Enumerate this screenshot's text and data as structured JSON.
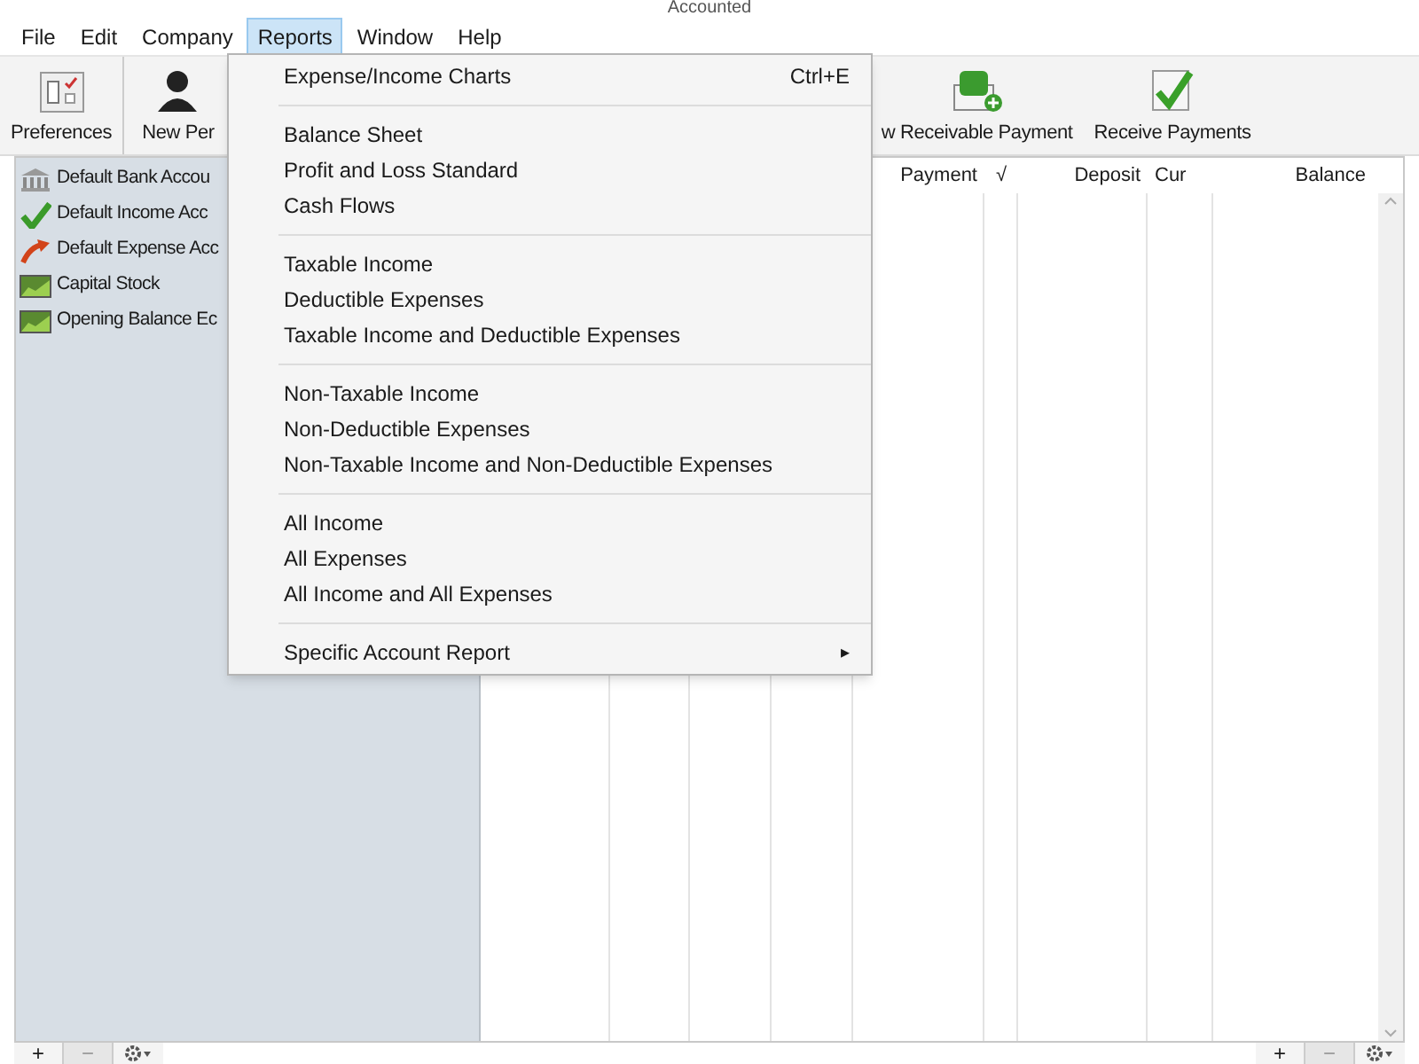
{
  "window": {
    "title": "Accounted"
  },
  "menubar": [
    {
      "label": "File",
      "selected": false
    },
    {
      "label": "Edit",
      "selected": false
    },
    {
      "label": "Company",
      "selected": false
    },
    {
      "label": "Reports",
      "selected": true
    },
    {
      "label": "Window",
      "selected": false
    },
    {
      "label": "Help",
      "selected": false
    }
  ],
  "toolbar": [
    {
      "label": "Preferences"
    },
    {
      "label": "New Per"
    },
    {
      "label": "w Receivable Payment"
    },
    {
      "label": "Receive Payments"
    }
  ],
  "sidebar": {
    "items": [
      {
        "label": "Default Bank Accou"
      },
      {
        "label": "Default Income Acc"
      },
      {
        "label": "Default Expense Acc"
      },
      {
        "label": "Capital Stock"
      },
      {
        "label": "Opening Balance Ec"
      }
    ]
  },
  "table": {
    "columns": [
      "Payment",
      "√",
      "Deposit",
      "Cur",
      "Balance"
    ]
  },
  "menu": {
    "items": [
      {
        "kind": "item",
        "label": "Expense/Income Charts",
        "shortcut": "Ctrl+E"
      },
      {
        "kind": "separator"
      },
      {
        "kind": "item",
        "label": "Balance Sheet"
      },
      {
        "kind": "item",
        "label": "Profit and Loss Standard"
      },
      {
        "kind": "item",
        "label": "Cash Flows"
      },
      {
        "kind": "separator"
      },
      {
        "kind": "item",
        "label": "Taxable Income"
      },
      {
        "kind": "item",
        "label": "Deductible Expenses"
      },
      {
        "kind": "item",
        "label": "Taxable Income and Deductible Expenses"
      },
      {
        "kind": "separator"
      },
      {
        "kind": "item",
        "label": "Non-Taxable Income"
      },
      {
        "kind": "item",
        "label": "Non-Deductible Expenses"
      },
      {
        "kind": "item",
        "label": "Non-Taxable Income and Non-Deductible Expenses"
      },
      {
        "kind": "separator"
      },
      {
        "kind": "item",
        "label": "All Income"
      },
      {
        "kind": "item",
        "label": "All Expenses"
      },
      {
        "kind": "item",
        "label": "All Income and All Expenses"
      },
      {
        "kind": "separator"
      },
      {
        "kind": "submenu",
        "label": "Specific Account Report",
        "arrow": "▸"
      }
    ]
  },
  "bottom_left": [
    "+",
    "−"
  ],
  "bottom_right": [
    "+",
    "−"
  ]
}
